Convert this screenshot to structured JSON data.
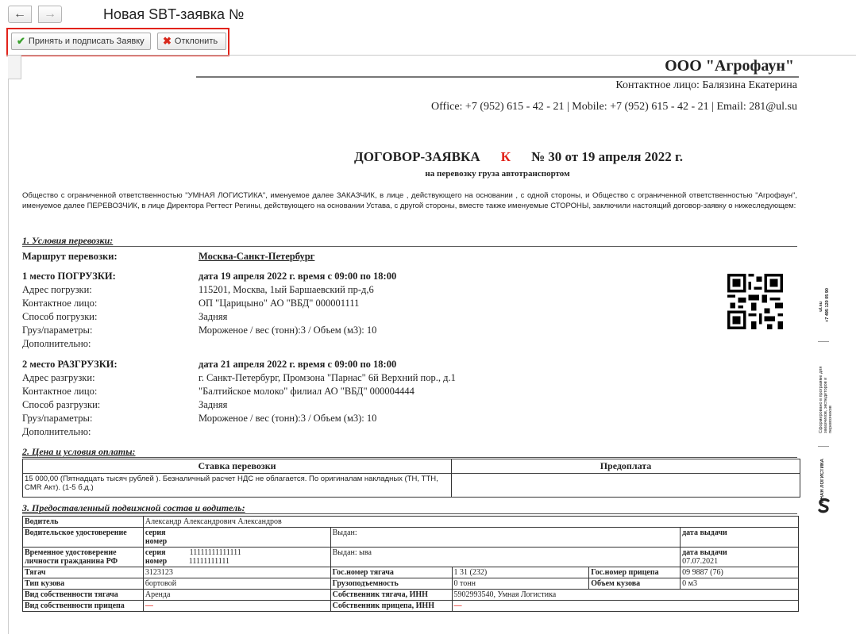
{
  "window": {
    "title": "Новая SBT-заявка №",
    "back_icon": "arrow-left-icon",
    "forward_icon": "arrow-right-icon"
  },
  "toolbar": {
    "accept_label": "Принять и подписать Заявку",
    "reject_label": "Отклонить"
  },
  "doc": {
    "company": "ООО \"Агрофаун\"",
    "contact": "Контактное лицо: Балязина Екатерина",
    "phones": "Office: +7 (952) 615 - 42 - 21 | Mobile: +7 (952) 615 - 42 - 21 | Email: 281@ul.su",
    "title_left": "ДОГОВОР-ЗАЯВКА",
    "title_k": "К",
    "title_right": "№ 30 от 19 апреля 2022 г.",
    "subtitle": "на перевозку груза автотранспортом",
    "intro": "Общество с ограниченной ответственностью \"УМНАЯ ЛОГИСТИКА\", именуемое далее ЗАКАЗЧИК, в лице      , действующего на основании , с одной стороны, и Общество с ограниченной ответственностью \"Агрофаун\", именуемое далее ПЕРЕВОЗЧИК, в лице Директора Регтест Регины, действующего на основании Устава, с другой стороны, вместе также именуемые СТОРОНЫ, заключили настоящий договор-заявку о нижеследующем:",
    "section1": "1. Условия перевозки:",
    "route_label": "Маршрут перевозки:",
    "route_value": "Москва-Санкт-Петербург",
    "load": {
      "title": "1 место ПОГРУЗКИ:",
      "date": "дата 19 апреля 2022 г.   время с 09:00 по 18:00",
      "addr_l": "Адрес погрузки:",
      "addr_v": "115201, Москва, 1ый Баршаевский пр-д,6",
      "cont_l": "Контактное лицо:",
      "cont_v": "ОП \"Царицыно\" АО \"ВБД\" 000001111",
      "way_l": "Способ погрузки:",
      "way_v": "Задняя",
      "cargo_l": "Груз/параметры:",
      "cargo_v": "Мороженое / вес (тонн):3 / Объем (м3): 10",
      "extra_l": "Дополнительно:"
    },
    "unload": {
      "title": "2 место РАЗГРУЗКИ:",
      "date": "дата 21 апреля 2022 г.   время с 09:00 по 18:00",
      "addr_l": "Адрес разгрузки:",
      "addr_v": "г. Санкт-Петербург, Промзона \"Парнас\" 6й Верхний пор., д.1",
      "cont_l": "Контактное лицо:",
      "cont_v": "\"Балтийское молоко\" филиал АО \"ВБД\" 000004444",
      "way_l": "Способ разгрузки:",
      "way_v": "Задняя",
      "cargo_l": "Груз/параметры:",
      "cargo_v": "Мороженое / вес (тонн):3 / Объем (м3): 10",
      "extra_l": "Дополнительно:"
    },
    "section2": "2. Цена и условия оплаты:",
    "pay": {
      "h_rate": "Ставка перевозки",
      "h_prepay": "Предоплата",
      "rate": "15 000,00 (Пятнадцать тысяч рублей ). Безналичный расчет НДС не облагается. По оригиналам накладных (ТН, ТТН, CMR Акт). (1-5 б.д.)",
      "prepay": ""
    },
    "section3": "3. Предоставленный подвижной состав и водитель:",
    "veh": {
      "driver_l": "Водитель",
      "driver_v": "Александр Александрович Александров",
      "lic_l": "Водительское удостоверение",
      "series": "серия",
      "number": "номер",
      "issued": "Выдан:",
      "issue_date": "дата выдачи",
      "tmp_l": "Временное удостоверение личности гражданина РФ",
      "tmp_series": "11111111111111",
      "tmp_number": "11111111111",
      "tmp_issued": "Выдан: ыва",
      "tmp_date": "07.07.2021",
      "truck_l": "Тягач",
      "truck_v": "3123123",
      "truck_plate_l": "Гос.номер тягача",
      "truck_plate_v": "1     31 (232)",
      "trailer_plate_l": "Гос.номер прицепа",
      "trailer_plate_v": "09 9887 (76)",
      "body_l": "Тип кузова",
      "body_v": "бортовой",
      "cap_l": "Грузоподъемность",
      "cap_v": "0 тонн",
      "vol_l": "Объем кузова",
      "vol_v": "0 м3",
      "own_truck_l": "Вид собственности тягача",
      "own_truck_v": "Аренда",
      "owner_truck_l": "Собственник тягача, ИНН",
      "owner_truck_v": "5902993540, Умная Логистика",
      "own_trailer_l": "Вид собственности прицепа",
      "own_trailer_v": "—",
      "owner_trailer_l": "Собственник прицепа, ИНН",
      "owner_trailer_v": "—"
    },
    "side": {
      "t1": "ul.su",
      "t2": "+7 495 120 05 90",
      "t3": "Сформировано в программе для заказчиков, экспедиторов и перевозчиков",
      "t4": "УМНАЯ ЛОГИСТИКА"
    }
  }
}
